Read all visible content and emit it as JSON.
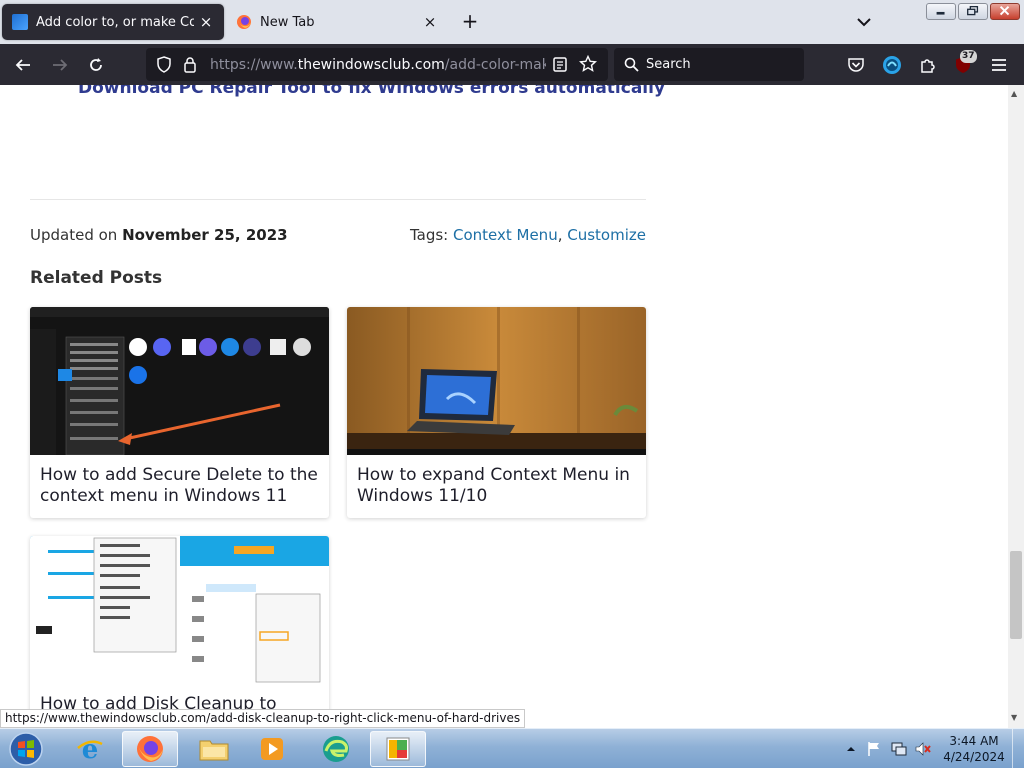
{
  "browser": {
    "tabs": [
      {
        "title": "Add color to, or make Context M",
        "active": true,
        "favicon": "windowsclub-favicon"
      },
      {
        "title": "New Tab",
        "active": false,
        "favicon": "firefox-favicon"
      }
    ],
    "new_tab_icon": "plus-icon",
    "url_prefix": "https://www.",
    "url_domain": "thewindowsclub.com",
    "url_path": "/add-color-make-con",
    "search_placeholder": "Search",
    "extension_badge": "37"
  },
  "page": {
    "promo_link": "Download PC Repair Tool to fix Windows errors automatically",
    "updated_prefix": "Updated on ",
    "updated_date": "November 25, 2023",
    "tags_label": "Tags: ",
    "tags": [
      "Context Menu",
      "Customize"
    ],
    "tags_separator": ", ",
    "related_heading": "Related Posts",
    "related_posts": [
      {
        "title": "How to add Secure Delete to the context menu in Windows 11"
      },
      {
        "title": "How to expand Context Menu in Windows 11/10"
      },
      {
        "title": "How to add Disk Cleanup to"
      }
    ]
  },
  "status_url": "https://www.thewindowsclub.com/add-disk-cleanup-to-right-click-menu-of-hard-drives",
  "taskbar": {
    "time": "3:44 AM",
    "date": "4/24/2024",
    "apps": [
      "start-orb",
      "internet-explorer",
      "firefox",
      "file-explorer",
      "media-player",
      "edge",
      "paint"
    ]
  },
  "colors": {
    "accent_link": "#1d6fa5",
    "promo_link": "#2f3b8f",
    "browser_dark": "#2b2a33",
    "taskbar": "#8fb1d6"
  }
}
